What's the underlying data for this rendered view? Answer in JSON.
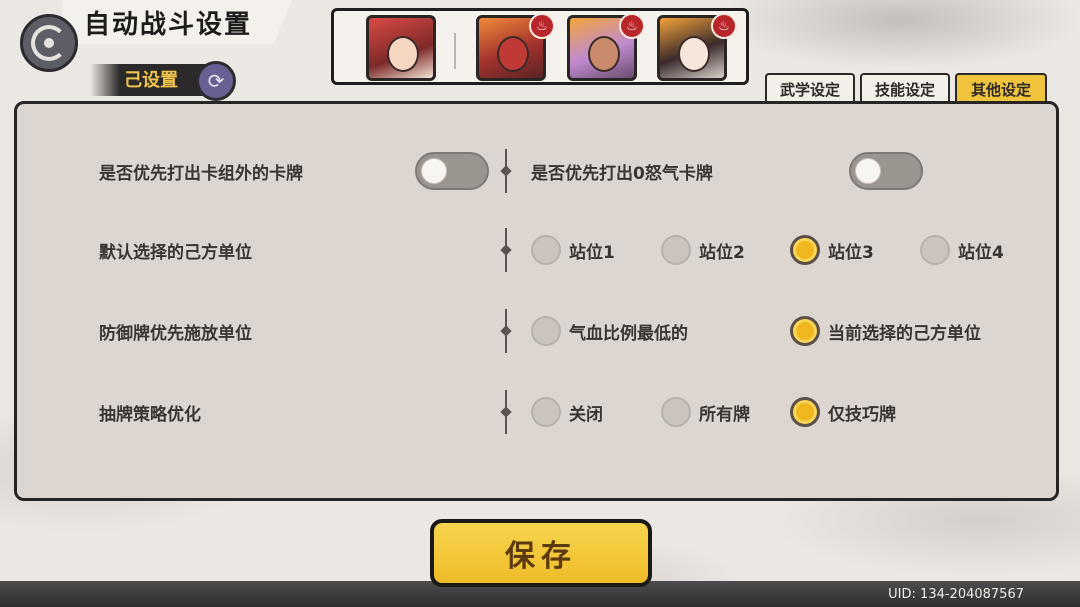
{
  "header": {
    "title": "自动战斗设置",
    "preset_label": "己设置"
  },
  "team": {
    "badges": [
      "♨",
      "♨",
      "♨"
    ]
  },
  "tabs": [
    {
      "label": "武学设定",
      "active": false
    },
    {
      "label": "技能设定",
      "active": false
    },
    {
      "label": "其他设定",
      "active": true
    }
  ],
  "settings": {
    "row1": {
      "left_label": "是否优先打出卡组外的卡牌",
      "left_toggle_on": false,
      "right_label": "是否优先打出0怒气卡牌",
      "right_toggle_on": false
    },
    "row2": {
      "label": "默认选择的己方单位",
      "options": [
        "站位1",
        "站位2",
        "站位3",
        "站位4"
      ],
      "selected": "站位3"
    },
    "row3": {
      "label": "防御牌优先施放单位",
      "options": [
        "气血比例最低的",
        "当前选择的己方单位"
      ],
      "selected": "当前选择的己方单位"
    },
    "row4": {
      "label": "抽牌策略优化",
      "options": [
        "关闭",
        "所有牌",
        "仅技巧牌"
      ],
      "selected": "仅技巧牌"
    }
  },
  "save_label": "保存",
  "uid_text": "UID:  134-204087567",
  "colors": {
    "accent": "#f0b81e",
    "panel": "#ddd6d0",
    "active_tab": "#f1c43e"
  }
}
